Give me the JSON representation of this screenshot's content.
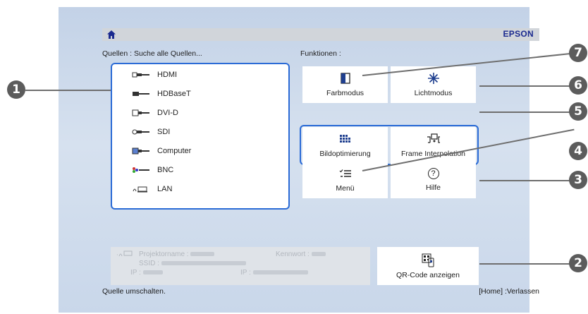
{
  "topbar": {
    "brand": "EPSON",
    "home_icon": "home-icon"
  },
  "sources_label": "Quellen : Suche alle Quellen...",
  "functions_label": "Funktionen :",
  "sources": [
    {
      "label": "HDMI",
      "icon": "hdmi-port-icon"
    },
    {
      "label": "HDBaseT",
      "icon": "hdbaset-port-icon"
    },
    {
      "label": "DVI-D",
      "icon": "dvi-port-icon"
    },
    {
      "label": "SDI",
      "icon": "sdi-port-icon"
    },
    {
      "label": "Computer",
      "icon": "computer-port-icon"
    },
    {
      "label": "BNC",
      "icon": "bnc-port-icon"
    },
    {
      "label": "LAN",
      "icon": "lan-icon"
    }
  ],
  "functions": {
    "color_mode": "Farbmodus",
    "light_mode": "Lichtmodus",
    "image_enhancement": "Bildoptimierung",
    "frame_interpolation": "Frame Interpolation",
    "menu": "Menü",
    "help": "Hilfe"
  },
  "info": {
    "projector_name_label": "Projektorname :",
    "password_label": "Kennwort :",
    "ssid_label": "SSID :",
    "ip_label_1": "IP :",
    "ip_label_2": "IP :"
  },
  "qr_button": "QR-Code anzeigen",
  "bottom": {
    "left": "Quelle umschalten.",
    "right": "[Home] :Verlassen"
  },
  "callouts": [
    "1",
    "2",
    "3",
    "4",
    "5",
    "6",
    "7"
  ],
  "colors": {
    "highlight": "#2b6bd6",
    "brand": "#1b2a8f",
    "callout": "#5c5c5c"
  }
}
